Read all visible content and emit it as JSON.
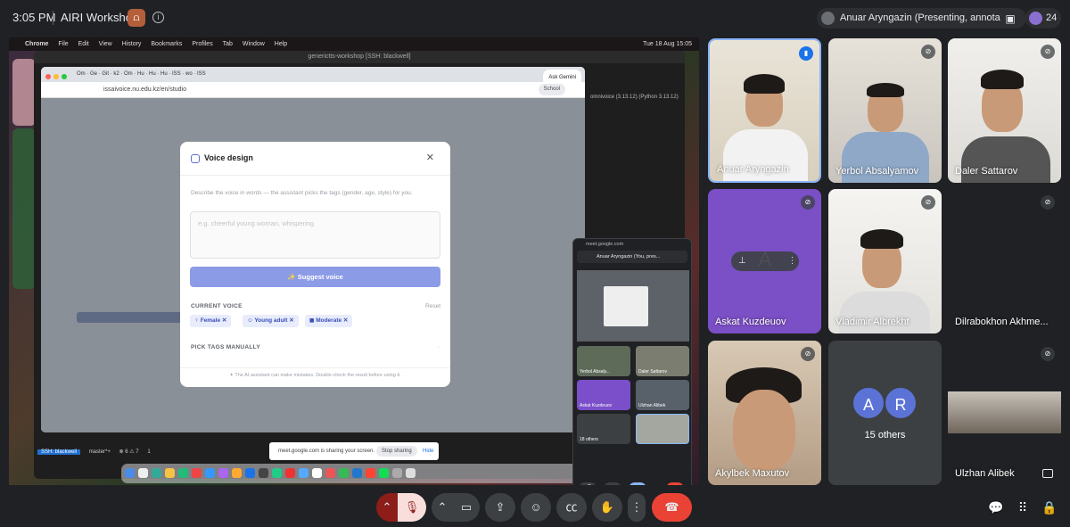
{
  "topbar": {
    "time": "3:05 PM",
    "meeting_title": "AIRI Workshop",
    "presenter": "Anuar Aryngazin (Presenting, annotating)",
    "participant_count": "24"
  },
  "screen": {
    "mac_menu": [
      "Chrome",
      "File",
      "Edit",
      "View",
      "History",
      "Bookmarks",
      "Profiles",
      "Tab",
      "Window",
      "Help"
    ],
    "mac_clock": "Tue 18 Aug 15:05",
    "terminal_title": "generictts-workshop [SSH: blackwell]",
    "ask_gemini": "Ask Gemini",
    "url": "issaivoice.nu.edu.kz/en/studio",
    "school_profile": "School",
    "term_right_text": "omnivoice (3.13.12) (Python 3.13.12)",
    "status_ssh": "SSH: blackwell",
    "status_branch": "master*+",
    "status_counts": "⊗ 6 ⚠ 7",
    "status_ports": "1",
    "share_text": "meet.google.com is sharing your screen.",
    "stop_sharing": "Stop sharing",
    "hide": "Hide"
  },
  "modal": {
    "title": "Voice design",
    "description": "Describe the voice in words — the assistant picks the tags (gender, age, style) for you.",
    "placeholder": "e.g. cheerful young woman, whispering",
    "suggest_button": "Suggest voice",
    "current_voice_label": "CURRENT VOICE",
    "reset": "Reset",
    "chips": [
      "Female",
      "Young adult",
      "Moderate"
    ],
    "pick_tags": "PICK TAGS MANUALLY",
    "note": "The AI assistant can make mistakes. Double-check the result before using it."
  },
  "pip": {
    "url": "meet.google.com",
    "presenting": "Anuar Aryngazin (You, pres...",
    "tiles": [
      "Yerbol Absaly...",
      "Daler Sattarov",
      "Askat Kuzdeuov",
      "Ulzhan Alibek",
      "18 others"
    ]
  },
  "participants": [
    {
      "name": "Anuar Aryngazin"
    },
    {
      "name": "Yerbol Absalyamov"
    },
    {
      "name": "Daler Sattarov"
    },
    {
      "name": "Askat Kuzdeuov",
      "initial": "A"
    },
    {
      "name": "Vladimir Albrekht"
    },
    {
      "name": "Dilrabokhon Akhme..."
    },
    {
      "name": "Akylbek Maxutov"
    },
    {
      "name": "15 others",
      "initials": [
        "A",
        "R"
      ]
    },
    {
      "name": "Ulzhan Alibek"
    }
  ]
}
